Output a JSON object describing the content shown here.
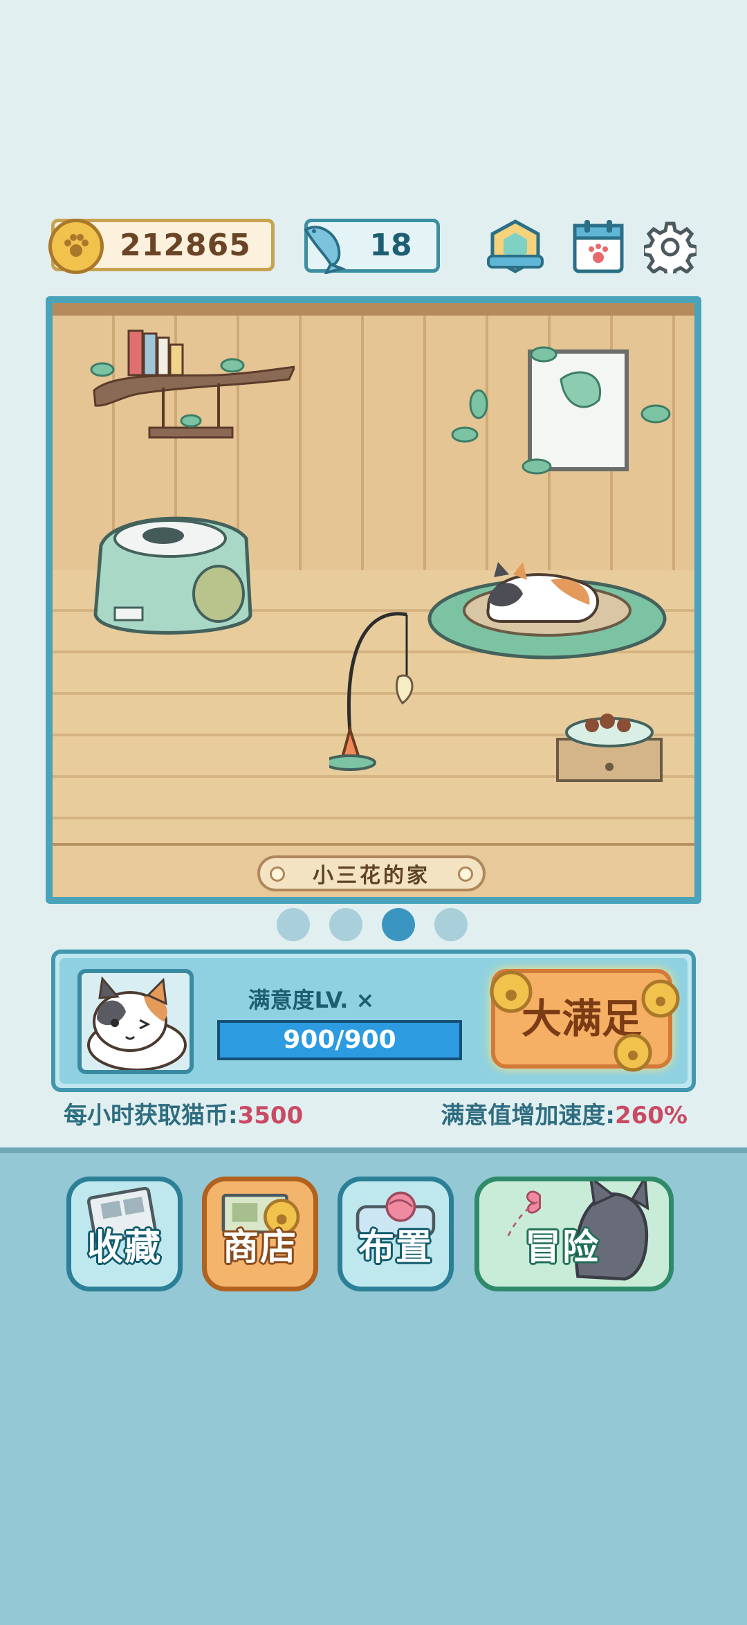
{
  "top_bar": {
    "coins": "212865",
    "fish": "18",
    "icons": [
      "paw-coin-icon",
      "fish-icon",
      "badge-icon",
      "calendar-icon",
      "gear-icon"
    ]
  },
  "room": {
    "name": "小三花的家",
    "page_count": 4,
    "active_page_index": 2
  },
  "satisfaction": {
    "title": "满意度LV. ×",
    "progress_text": "900/900",
    "progress_fraction": 1.0,
    "button_label": "大满足"
  },
  "stats": {
    "coins_per_hour_label": "每小时获取猫币:",
    "coins_per_hour_value": "3500",
    "speed_label": "满意值增加速度:",
    "speed_value": "260%"
  },
  "menu": {
    "collection": "收藏",
    "shop": "商店",
    "layout": "布置",
    "adventure": "冒险"
  },
  "colors": {
    "background": "#e1eff0",
    "bottom_panel": "#94c8d5",
    "accent_blue": "#4296ad",
    "accent_pink": "#c94a64",
    "coin_gold": "#f1c24c"
  }
}
